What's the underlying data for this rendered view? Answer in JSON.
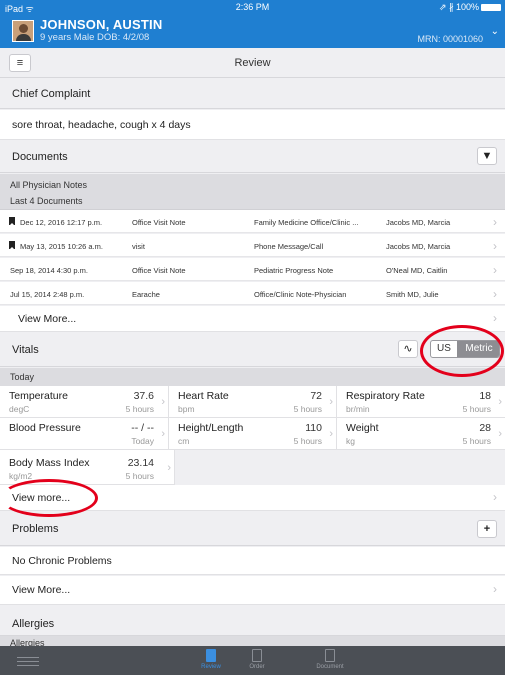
{
  "status": {
    "carrier": "iPad ᯤ",
    "time": "2:36 PM",
    "battery": "⇗ ∦ 100%"
  },
  "patient": {
    "name": "JOHNSON, AUSTIN",
    "demographics": "9 years  Male  DOB: 4/2/08",
    "mrn": "MRN: 00001060"
  },
  "toolbar": {
    "title": "Review"
  },
  "chief_complaint": {
    "header": "Chief Complaint",
    "text": "sore throat, headache, cough x 4 days"
  },
  "documents": {
    "header": "Documents",
    "group_title": "All Physician Notes",
    "group_subtitle": "Last 4 Documents",
    "rows": [
      {
        "date": "Dec 12, 2016 12:17 p.m.",
        "type": "Office Visit Note",
        "title": "Family Medicine Office/Clinic ...",
        "author": "Jacobs MD, Marcia",
        "bookmarked": true
      },
      {
        "date": "May 13, 2015 10:26 a.m.",
        "type": "visit",
        "title": "Phone Message/Call",
        "author": "Jacobs MD, Marcia",
        "bookmarked": true
      },
      {
        "date": "Sep 18, 2014 4:30 p.m.",
        "type": "Office Visit Note",
        "title": "Pediatric Progress Note",
        "author": "O'Neal MD, Caitlin",
        "bookmarked": false
      },
      {
        "date": "Jul 15, 2014 2:48 p.m.",
        "type": "Earache",
        "title": "Office/Clinic Note-Physician",
        "author": "Smith MD, Julie",
        "bookmarked": false
      }
    ],
    "view_more": "View More..."
  },
  "vitals": {
    "header": "Vitals",
    "unit_us": "US",
    "unit_metric": "Metric",
    "group": "Today",
    "items": [
      {
        "name": "Temperature",
        "unit": "degC",
        "value": "37.6",
        "time": "5 hours"
      },
      {
        "name": "Heart Rate",
        "unit": "bpm",
        "value": "72",
        "time": "5 hours"
      },
      {
        "name": "Respiratory Rate",
        "unit": "br/min",
        "value": "18",
        "time": "5 hours"
      },
      {
        "name": "Blood Pressure",
        "unit": "",
        "value": "-- / --",
        "time": "Today"
      },
      {
        "name": "Height/Length",
        "unit": "cm",
        "value": "110",
        "time": "5 hours"
      },
      {
        "name": "Weight",
        "unit": "kg",
        "value": "28",
        "time": "5 hours"
      },
      {
        "name": "Body Mass Index",
        "unit": "kg/m2",
        "value": "23.14",
        "time": "5 hours"
      }
    ],
    "view_more": "View more..."
  },
  "problems": {
    "header": "Problems",
    "row": "No Chronic Problems",
    "view_more": "View More..."
  },
  "allergies": {
    "header": "Allergies",
    "sub": "Allergies"
  },
  "tabs": [
    {
      "label": "Review",
      "active": true
    },
    {
      "label": "Order",
      "active": false
    },
    {
      "label": "Document",
      "active": false
    }
  ],
  "colors": {
    "header": "#1f7fd1",
    "tabbar": "#4b4f55",
    "active_tab": "#3b8fe0",
    "annotation": "#e3001b"
  }
}
